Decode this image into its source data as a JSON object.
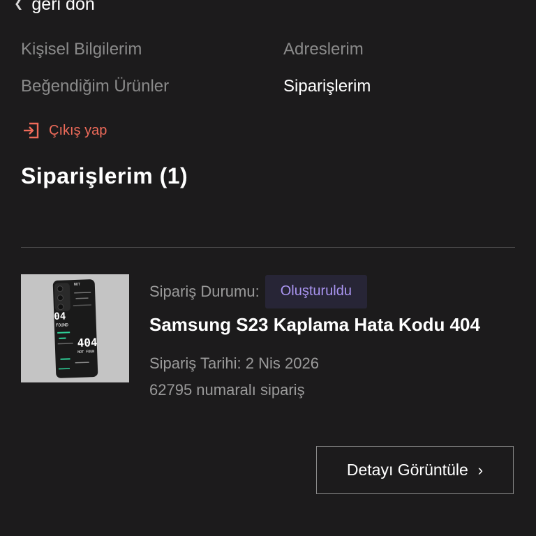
{
  "nav": {
    "back_label": "geri dön"
  },
  "account_menu": {
    "items": [
      {
        "label": "Kişisel Bilgilerim"
      },
      {
        "label": "Adreslerim"
      },
      {
        "label": "Beğendiğim Ürünler"
      },
      {
        "label": "Siparişlerim"
      }
    ],
    "active": "Siparişlerim",
    "logout_label": "Çıkış yap"
  },
  "orders": {
    "section_title": "Siparişlerim (1)",
    "items": [
      {
        "status_label": "Sipariş Durumu:",
        "status_value": "Oluşturuldu",
        "product_name": "Samsung S23 Kaplama Hata Kodu 404",
        "order_date": "Sipariş Tarihi: 2 Nis 2026",
        "order_number": "62795 numaralı sipariş",
        "detail_button_label": "Detayı Görüntüle",
        "image_texts": [
          "04",
          "NOT",
          "FOUND",
          "404",
          "NOT FOUN"
        ]
      }
    ]
  },
  "colors": {
    "background": "#1c1b1c",
    "logout_accent": "#ef6b5a",
    "status_badge_text": "#a994f0",
    "status_badge_bg": "#272536",
    "muted_text": "#8a8a8a"
  },
  "icons": {
    "back": "chevron-left-icon",
    "logout": "logout-icon",
    "detail": "chevron-right-icon"
  }
}
